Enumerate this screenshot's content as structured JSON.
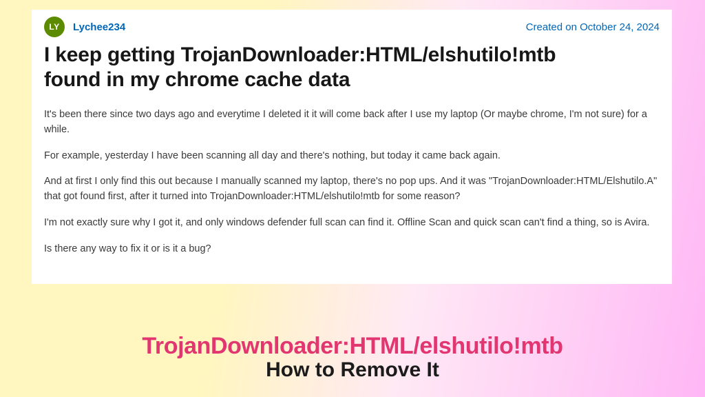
{
  "post": {
    "author": {
      "initials": "LY",
      "name": "Lychee234"
    },
    "created_label": "Created on October 24, 2024",
    "title": "I keep getting TrojanDownloader:HTML/elshutilo!mtb found in my chrome cache data",
    "paragraphs": [
      "It's been there since two days ago and everytime I deleted it it will come back after I use my laptop (Or maybe chrome, I'm not sure) for a while.",
      "For example, yesterday I have been scanning all day and there's nothing, but today it came back again.",
      "And at first I only find this out because I manually scanned my laptop, there's no pop ups. And it was \"TrojanDownloader:HTML/Elshutilo.A\" that got found first, after it turned into TrojanDownloader:HTML/elshutilo!mtb for some reason?",
      "I'm not exactly sure why I got it, and only windows defender full scan can find it. Offline Scan and quick scan can't find a thing, so is Avira.",
      "Is there any way to fix it or is it a bug?"
    ]
  },
  "footer": {
    "threat_name": "TrojanDownloader:HTML/elshutilo!mtb",
    "subtitle": "How to Remove It"
  },
  "colors": {
    "accent_pink": "#e13670",
    "link_blue": "#0067b8",
    "avatar_green": "#5d8b00"
  }
}
